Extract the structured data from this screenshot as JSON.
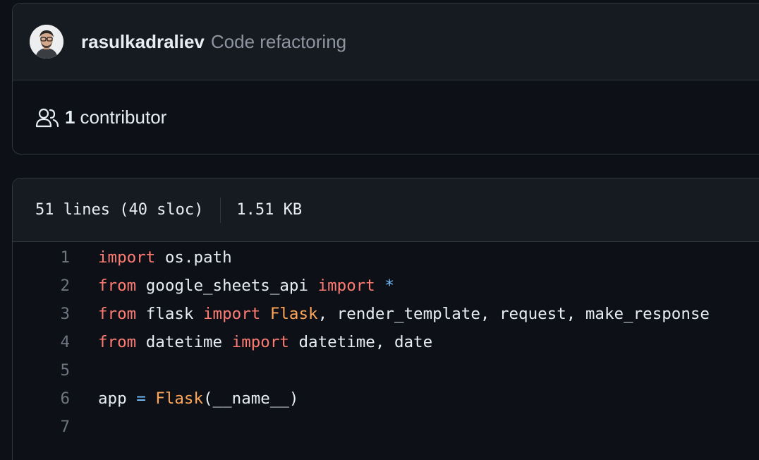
{
  "commit": {
    "author": "rasulkadraliev",
    "message": "Code refactoring"
  },
  "contributors": {
    "count": "1",
    "label": "contributor",
    "icon": "people-icon"
  },
  "file_info": {
    "lines": "51 lines (40 sloc)",
    "size": "1.51 KB"
  },
  "code_lines": [
    {
      "number": "1",
      "tokens": [
        {
          "t": "import",
          "c": "kw"
        },
        {
          "t": " os.path",
          "c": ""
        }
      ]
    },
    {
      "number": "2",
      "tokens": [
        {
          "t": "from",
          "c": "kw"
        },
        {
          "t": " google_sheets_api ",
          "c": ""
        },
        {
          "t": "import",
          "c": "kw"
        },
        {
          "t": " ",
          "c": ""
        },
        {
          "t": "*",
          "c": "op"
        }
      ]
    },
    {
      "number": "3",
      "tokens": [
        {
          "t": "from",
          "c": "kw"
        },
        {
          "t": " flask ",
          "c": ""
        },
        {
          "t": "import",
          "c": "kw"
        },
        {
          "t": " ",
          "c": ""
        },
        {
          "t": "Flask",
          "c": "cls"
        },
        {
          "t": ", render_template, request, make_response",
          "c": ""
        }
      ]
    },
    {
      "number": "4",
      "tokens": [
        {
          "t": "from",
          "c": "kw"
        },
        {
          "t": " datetime ",
          "c": ""
        },
        {
          "t": "import",
          "c": "kw"
        },
        {
          "t": " datetime, date",
          "c": ""
        }
      ]
    },
    {
      "number": "5",
      "tokens": []
    },
    {
      "number": "6",
      "tokens": [
        {
          "t": "app ",
          "c": ""
        },
        {
          "t": "=",
          "c": "op"
        },
        {
          "t": " ",
          "c": ""
        },
        {
          "t": "Flask",
          "c": "cls"
        },
        {
          "t": "(__name__)",
          "c": ""
        }
      ]
    },
    {
      "number": "7",
      "tokens": []
    }
  ],
  "colors": {
    "background": "#0d1117",
    "keyword": "#ff7b72",
    "class": "#ffa657",
    "operator": "#79c0ff"
  }
}
